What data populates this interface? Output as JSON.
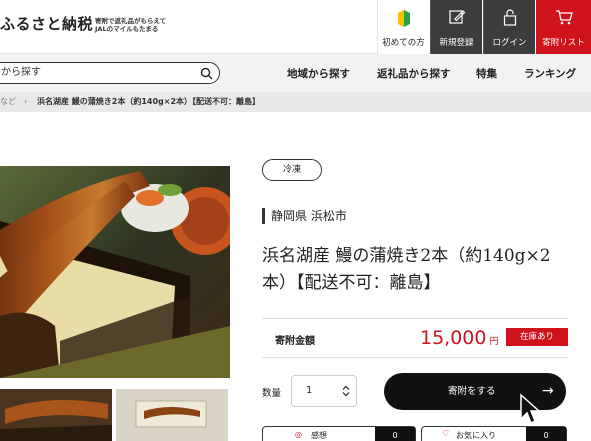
{
  "header": {
    "logo": "ふるさと納税",
    "tagline_line1": "寄附で返礼品がもらえて",
    "tagline_line2": "JALのマイルもたまる",
    "buttons": [
      {
        "label": "初めての方",
        "icon": "beginner-mark-icon"
      },
      {
        "label": "新規登録",
        "icon": "register-icon"
      },
      {
        "label": "ログイン",
        "icon": "lock-icon"
      },
      {
        "label": "寄附リスト",
        "icon": "cart-icon"
      }
    ],
    "colors": {
      "dark": "#3c3c3c",
      "accent": "#d0121b"
    }
  },
  "nav": {
    "search_placeholder": "から探す",
    "links": [
      "地域から探す",
      "返礼品から探す",
      "特集",
      "ランキング"
    ]
  },
  "breadcrumb": {
    "separator": "など　›",
    "current": "浜名湖産 鰻の蒲焼き2本（約140g×2本）【配送不可：離島】"
  },
  "product": {
    "tag": "冷凍",
    "location": "静岡県 浜松市",
    "title_line1": "浜名湖産 鰻の蒲焼き2本（約140g×2",
    "title_line2": "本）【配送不可：離島】",
    "amount_label": "寄附金額",
    "price": "15,000",
    "currency": "円",
    "stock": "在庫あり",
    "qty_label": "数量",
    "qty_value": "1",
    "donate_label": "寄附をする",
    "donate_arrow": "→",
    "support_label": "感想",
    "favorite_label": "お気に入り",
    "support_count": "0",
    "favorite_count": "0"
  }
}
